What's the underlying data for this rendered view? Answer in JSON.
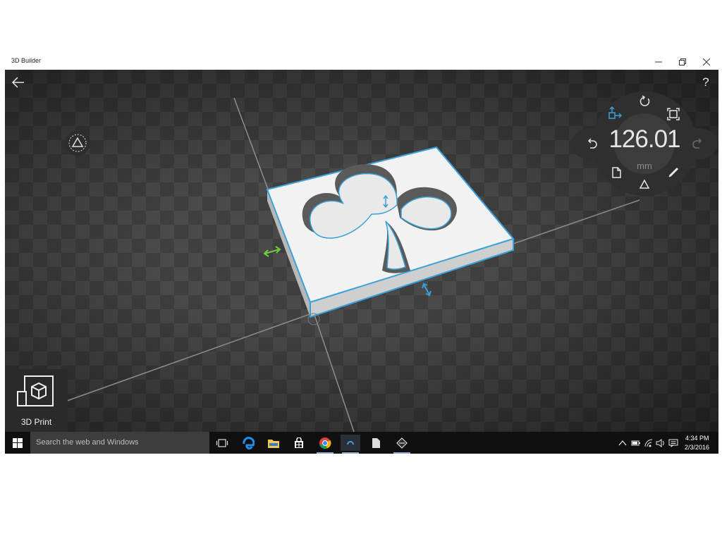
{
  "window": {
    "title": "3D Builder",
    "controls": [
      "minimize",
      "restore",
      "close"
    ]
  },
  "toolbar": {
    "back_icon": "arrow-left-icon",
    "help_label": "?"
  },
  "dial": {
    "value": "126.01",
    "unit": "mm",
    "items": [
      "rotate-icon",
      "scale-icon",
      "move-icon",
      "undo-icon",
      "redo-icon",
      "document-icon",
      "triangle-icon",
      "pencil-icon"
    ]
  },
  "print_button": {
    "label": "3D Print",
    "icon": "3d-print-icon"
  },
  "taskbar": {
    "search_placeholder": "Search the web and Windows",
    "icons": [
      "windows-start-icon",
      "task-view-icon",
      "edge-icon",
      "file-explorer-icon",
      "store-icon",
      "chrome-icon",
      "3d-builder-icon",
      "document-icon",
      "pen-app-icon"
    ],
    "tray_icons": [
      "chevron-up-icon",
      "battery-icon",
      "wifi-icon",
      "volume-icon",
      "notification-icon"
    ],
    "time": "4:34 PM",
    "date": "2/3/2016"
  },
  "colors": {
    "accent": "#3aa0d8",
    "handle_green": "#6fcf3a"
  }
}
